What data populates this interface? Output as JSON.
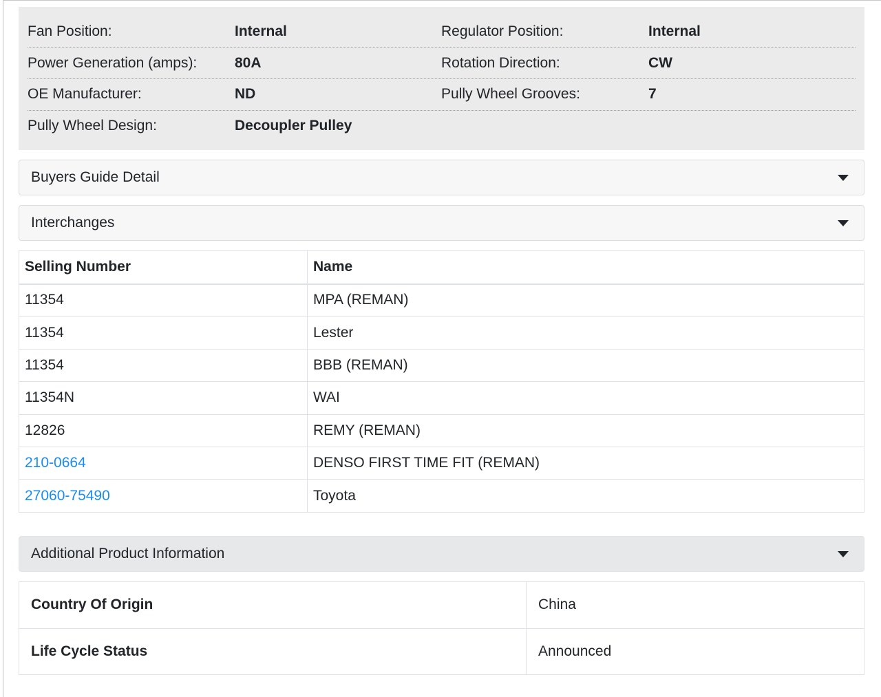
{
  "specs": [
    [
      {
        "label": "Fan Position:",
        "value": "Internal"
      },
      {
        "label": "Regulator Position:",
        "value": "Internal"
      }
    ],
    [
      {
        "label": "Power Generation (amps):",
        "value": "80A"
      },
      {
        "label": "Rotation Direction:",
        "value": "CW"
      }
    ],
    [
      {
        "label": "OE Manufacturer:",
        "value": "ND"
      },
      {
        "label": "Pully Wheel Grooves:",
        "value": "7"
      }
    ],
    [
      {
        "label": "Pully Wheel Design:",
        "value": "Decoupler Pulley"
      }
    ]
  ],
  "sections": {
    "buyers_guide": "Buyers Guide Detail",
    "interchanges": "Interchanges",
    "additional_info": "Additional Product Information"
  },
  "interchanges": {
    "headers": [
      "Selling Number",
      "Name"
    ],
    "rows": [
      {
        "number": "11354",
        "name": "MPA (REMAN)",
        "link": false
      },
      {
        "number": "11354",
        "name": "Lester",
        "link": false
      },
      {
        "number": "11354",
        "name": "BBB (REMAN)",
        "link": false
      },
      {
        "number": "11354N",
        "name": "WAI",
        "link": false
      },
      {
        "number": "12826",
        "name": "REMY (REMAN)",
        "link": false
      },
      {
        "number": "210-0664",
        "name": "DENSO FIRST TIME FIT (REMAN)",
        "link": true
      },
      {
        "number": "27060-75490",
        "name": "Toyota",
        "link": true
      }
    ]
  },
  "additional_info": [
    {
      "key": "Country Of Origin",
      "value": "China"
    },
    {
      "key": "Life Cycle Status",
      "value": "Announced"
    }
  ],
  "colors": {
    "link": "#1a8cf0",
    "panel": "#ebebeb"
  }
}
